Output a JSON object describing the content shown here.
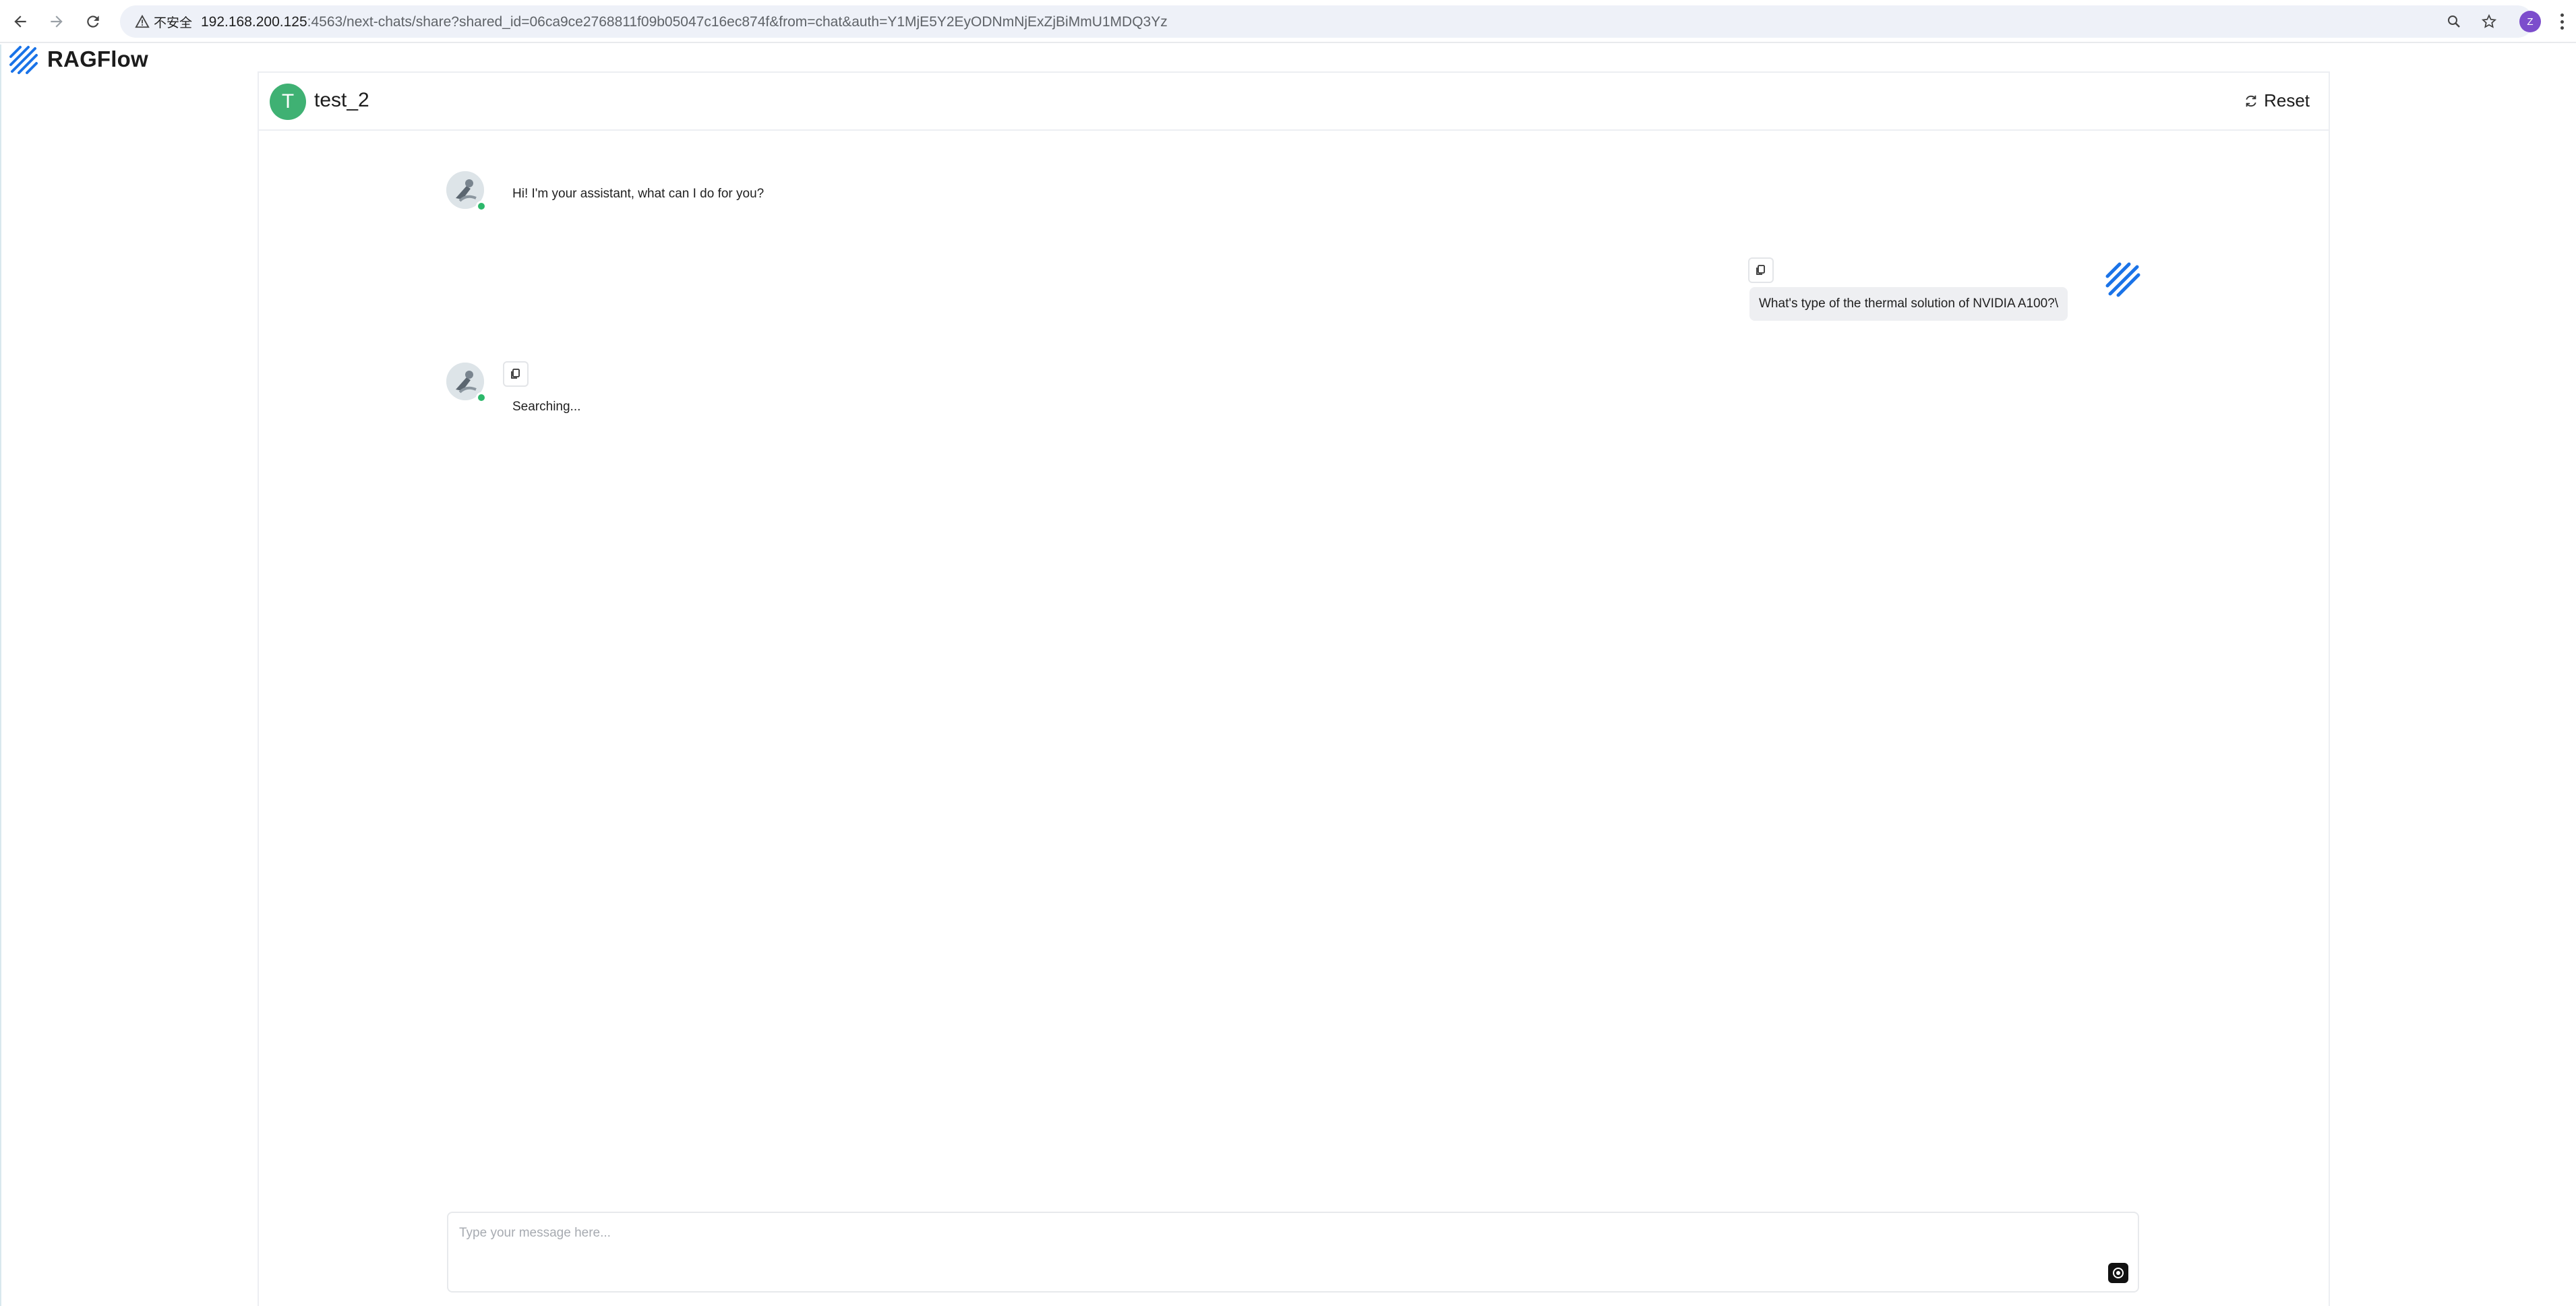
{
  "browser": {
    "security_label": "不安全",
    "url_host": "192.168.200.125",
    "url_rest": ":4563/next-chats/share?shared_id=06ca9ce2768811f09b05047c16ec874f&from=chat&auth=Y1MjE5Y2EyODNmNjExZjBiMmU1MDQ3Yz",
    "profile_initial": "Z"
  },
  "brand": {
    "name": "RAGFlow"
  },
  "chat": {
    "avatar_letter": "T",
    "title": "test_2",
    "reset_label": "Reset"
  },
  "messages": {
    "greeting": "Hi! I'm your assistant, what can I do for you?",
    "user_question": "What's type of the thermal solution of NVIDIA A100?\\",
    "assistant_status": "Searching..."
  },
  "composer": {
    "placeholder": "Type your message here..."
  },
  "colors": {
    "brand_blue": "#1a73e8",
    "online_green": "#2db86b",
    "chat_avatar_green": "#3fb173"
  }
}
